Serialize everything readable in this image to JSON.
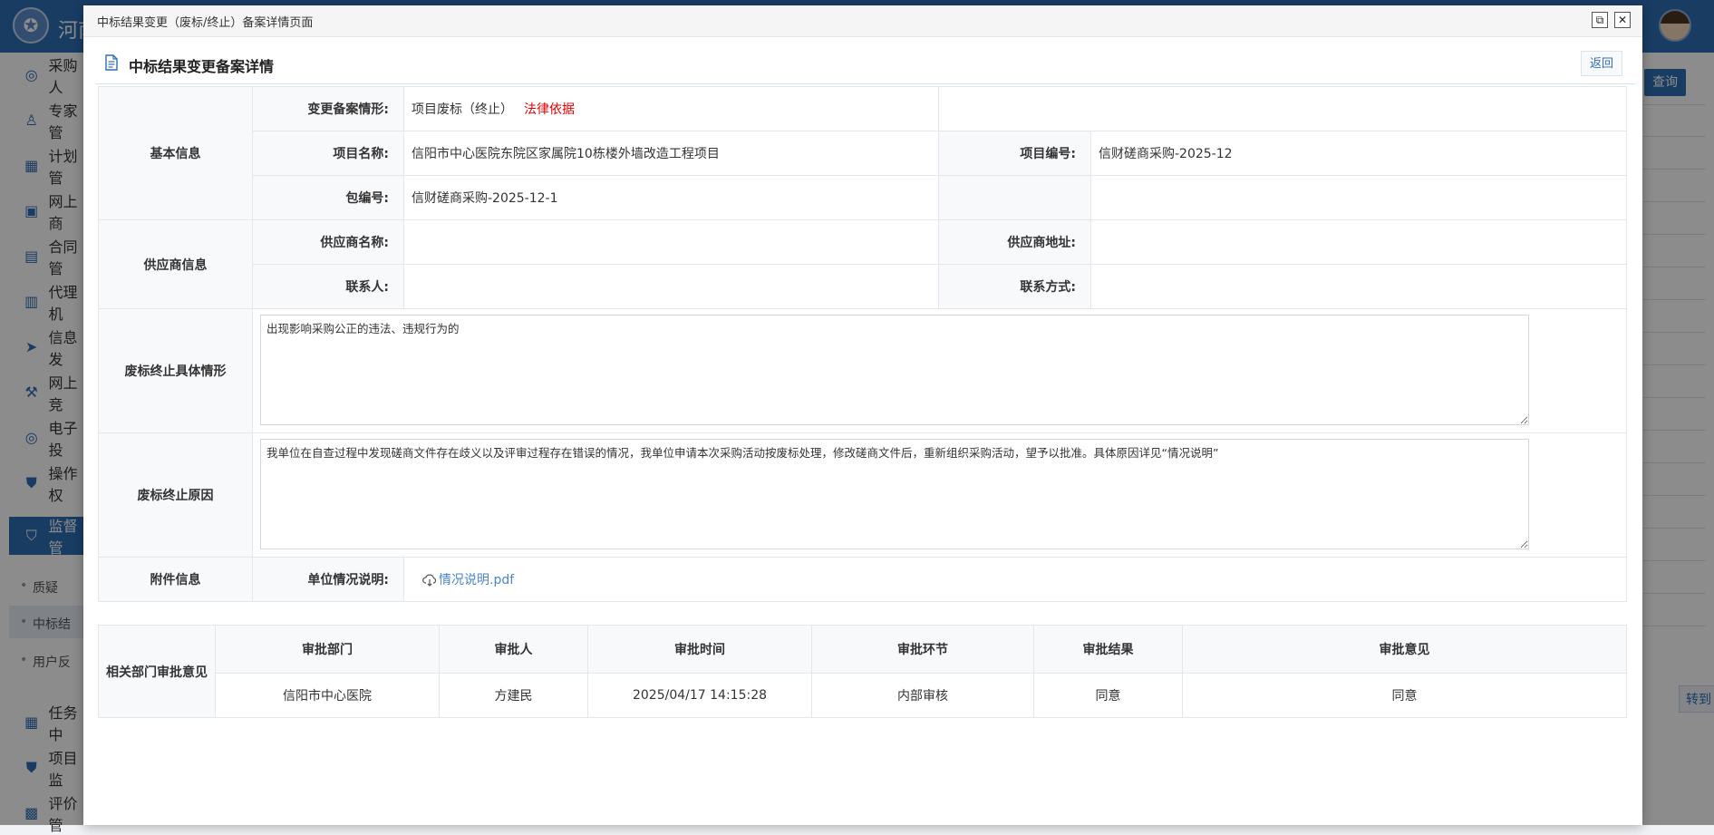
{
  "app": {
    "title": "河南",
    "logo_icon": "emblem-icon",
    "query_label": "查询",
    "goto_label": "转到"
  },
  "sidebar": {
    "items": [
      {
        "label": "采购人",
        "icon": "target-icon"
      },
      {
        "label": "专家管",
        "icon": "user-icon"
      },
      {
        "label": "计划管",
        "icon": "calendar-icon"
      },
      {
        "label": "网上商",
        "icon": "shop-icon"
      },
      {
        "label": "合同管",
        "icon": "contract-icon"
      },
      {
        "label": "代理机",
        "icon": "building-icon"
      },
      {
        "label": "信息发",
        "icon": "send-icon"
      },
      {
        "label": "网上竞",
        "icon": "hammer-icon"
      },
      {
        "label": "电子投",
        "icon": "target-icon"
      },
      {
        "label": "操作权",
        "icon": "shield-icon"
      },
      {
        "label": "监督管",
        "icon": "shield-check-icon"
      },
      {
        "label": "任务中",
        "icon": "task-icon"
      },
      {
        "label": "项目监",
        "icon": "shield-icon"
      },
      {
        "label": "评价管",
        "icon": "user-card-icon"
      }
    ],
    "sub_items": [
      "质疑",
      "中标结",
      "用户反"
    ]
  },
  "modal": {
    "window_title": "中标结果变更（废标/终止）备案详情页面",
    "heading": "中标结果变更备案详情",
    "back_label": "返回"
  },
  "basic": {
    "category": "基本信息",
    "case_label": "变更备案情形:",
    "case_value": "项目废标（终止）",
    "legal_basis": "法律依据",
    "project_name_label": "项目名称:",
    "project_name": "信阳市中心医院东院区家属院10栋楼外墙改造工程项目",
    "project_no_label": "项目编号:",
    "project_no": "信财磋商采购-2025-12",
    "package_no_label": "包编号:",
    "package_no": "信财磋商采购-2025-12-1"
  },
  "supplier": {
    "category": "供应商信息",
    "name_label": "供应商名称:",
    "name_value": "",
    "address_label": "供应商地址:",
    "address_value": "",
    "contact_label": "联系人:",
    "contact_value": "",
    "phone_label": "联系方式:",
    "phone_value": ""
  },
  "termination": {
    "situation_label": "废标终止具体情形",
    "situation_text": "出现影响采购公正的违法、违规行为的",
    "reason_label": "废标终止原因",
    "reason_text": "我单位在自查过程中发现磋商文件存在歧义以及评审过程存在错误的情况，我单位申请本次采购活动按废标处理，修改磋商文件后，重新组织采购活动，望予以批准。具体原因详见“情况说明”"
  },
  "attachment": {
    "category": "附件信息",
    "label": "单位情况说明:",
    "file_name": "情况说明.pdf",
    "icon": "cloud-download-icon"
  },
  "approval": {
    "category": "相关部门审批意见",
    "headers": [
      "审批部门",
      "审批人",
      "审批时间",
      "审批环节",
      "审批结果",
      "审批意见"
    ],
    "rows": [
      [
        "信阳市中心医院",
        "方建民",
        "2025/04/17 14:15:28",
        "内部审核",
        "同意",
        "同意"
      ]
    ]
  }
}
